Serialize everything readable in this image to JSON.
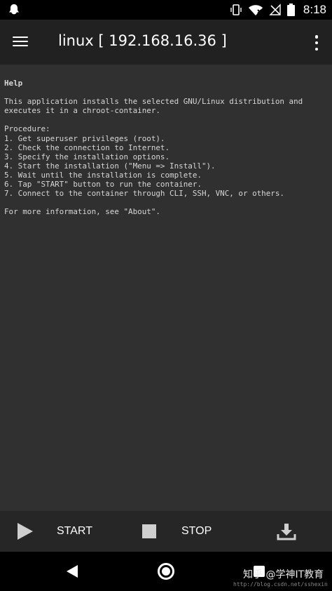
{
  "status_bar": {
    "time": "8:18",
    "icons": [
      "ghost-notification-icon",
      "vibrate-icon",
      "wifi-off-icon",
      "no-signal-icon",
      "battery-icon"
    ]
  },
  "toolbar": {
    "title": "linux  [ 192.168.16.36 ]",
    "menu_icon": "hamburger-menu-icon",
    "overflow_icon": "more-vert-icon"
  },
  "help": {
    "title": "Help",
    "intro_lines": [
      "This application installs the selected GNU/Linux distribution and",
      "executes it in a chroot-container."
    ],
    "procedure_label": "Procedure:",
    "steps": [
      "1. Get superuser privileges (root).",
      "2. Check the connection to Internet.",
      "3. Specify the installation options.",
      "4. Start the installation (\"Menu => Install\").",
      "5. Wait until the installation is complete.",
      "6. Tap \"START\" button to run the container.",
      "7. Connect to the container through CLI, SSH, VNC, or others."
    ],
    "more_info": "For more information, see \"About\"."
  },
  "bottom_bar": {
    "start_label": "START",
    "stop_label": "STOP",
    "download_icon": "download-icon"
  },
  "watermark": {
    "text": "知乎 @学神IT教育",
    "url": "http://blog.csdn.net/sshexin"
  },
  "colors": {
    "toolbar_bg": "#212121",
    "content_bg": "#303030",
    "text": "#d6d6d6"
  }
}
